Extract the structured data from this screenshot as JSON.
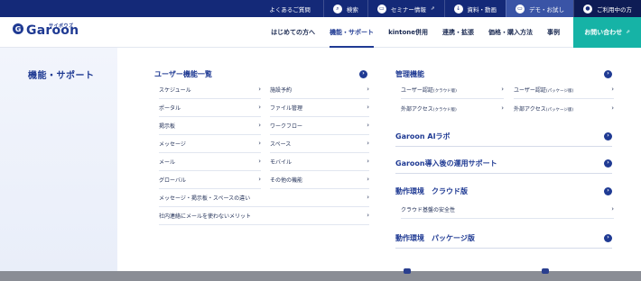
{
  "topbar": {
    "faq": "よくあるご質問",
    "search": "検索",
    "seminar": "セミナー情報",
    "docs": "資料・動画",
    "demo": "デモ・お試し",
    "current_user": "ご利用中の方"
  },
  "header": {
    "logo_text": "Garoon",
    "logo_kana": "サイボウズ",
    "nav": [
      "はじめての方へ",
      "機能・サポート",
      "kintone併用",
      "連携・拡張",
      "価格・購入方法",
      "事例"
    ],
    "contact": "お問い合わせ"
  },
  "mega": {
    "side_title": "機能・サポート",
    "user_features": {
      "title": "ユーザー機能一覧",
      "col1": [
        "スケジュール",
        "ポータル",
        "掲示板",
        "メッセージ",
        "メール",
        "グローバル"
      ],
      "col2": [
        "施設予約",
        "ファイル管理",
        "ワークフロー",
        "スペース",
        "モバイル",
        "その他の機能"
      ],
      "wide": [
        "メッセージ・掲示板・スペースの違い",
        "社内連絡にメールを使わないメリット"
      ]
    },
    "admin": {
      "title": "管理機能",
      "items": [
        {
          "label": "ユーザー認証",
          "note": "(クラウド版)"
        },
        {
          "label": "ユーザー認証",
          "note": "(パッケージ版)"
        },
        {
          "label": "外部アクセス",
          "note": "(クラウド版)"
        },
        {
          "label": "外部アクセス",
          "note": "(パッケージ版)"
        }
      ]
    },
    "ai_lab": "Garoon AIラボ",
    "support": "Garoon導入後の運用サポート",
    "env_cloud": {
      "title": "動作環境　クラウド版",
      "items": [
        "クラウド基盤の安全性"
      ]
    },
    "env_package": "動作環境　パッケージ版"
  },
  "icons": {
    "chevron": "›",
    "arrow": "›",
    "external": "⇗"
  },
  "colors": {
    "topbar": "#142978",
    "brand": "#1f3a93",
    "contact": "#16b3a6"
  }
}
